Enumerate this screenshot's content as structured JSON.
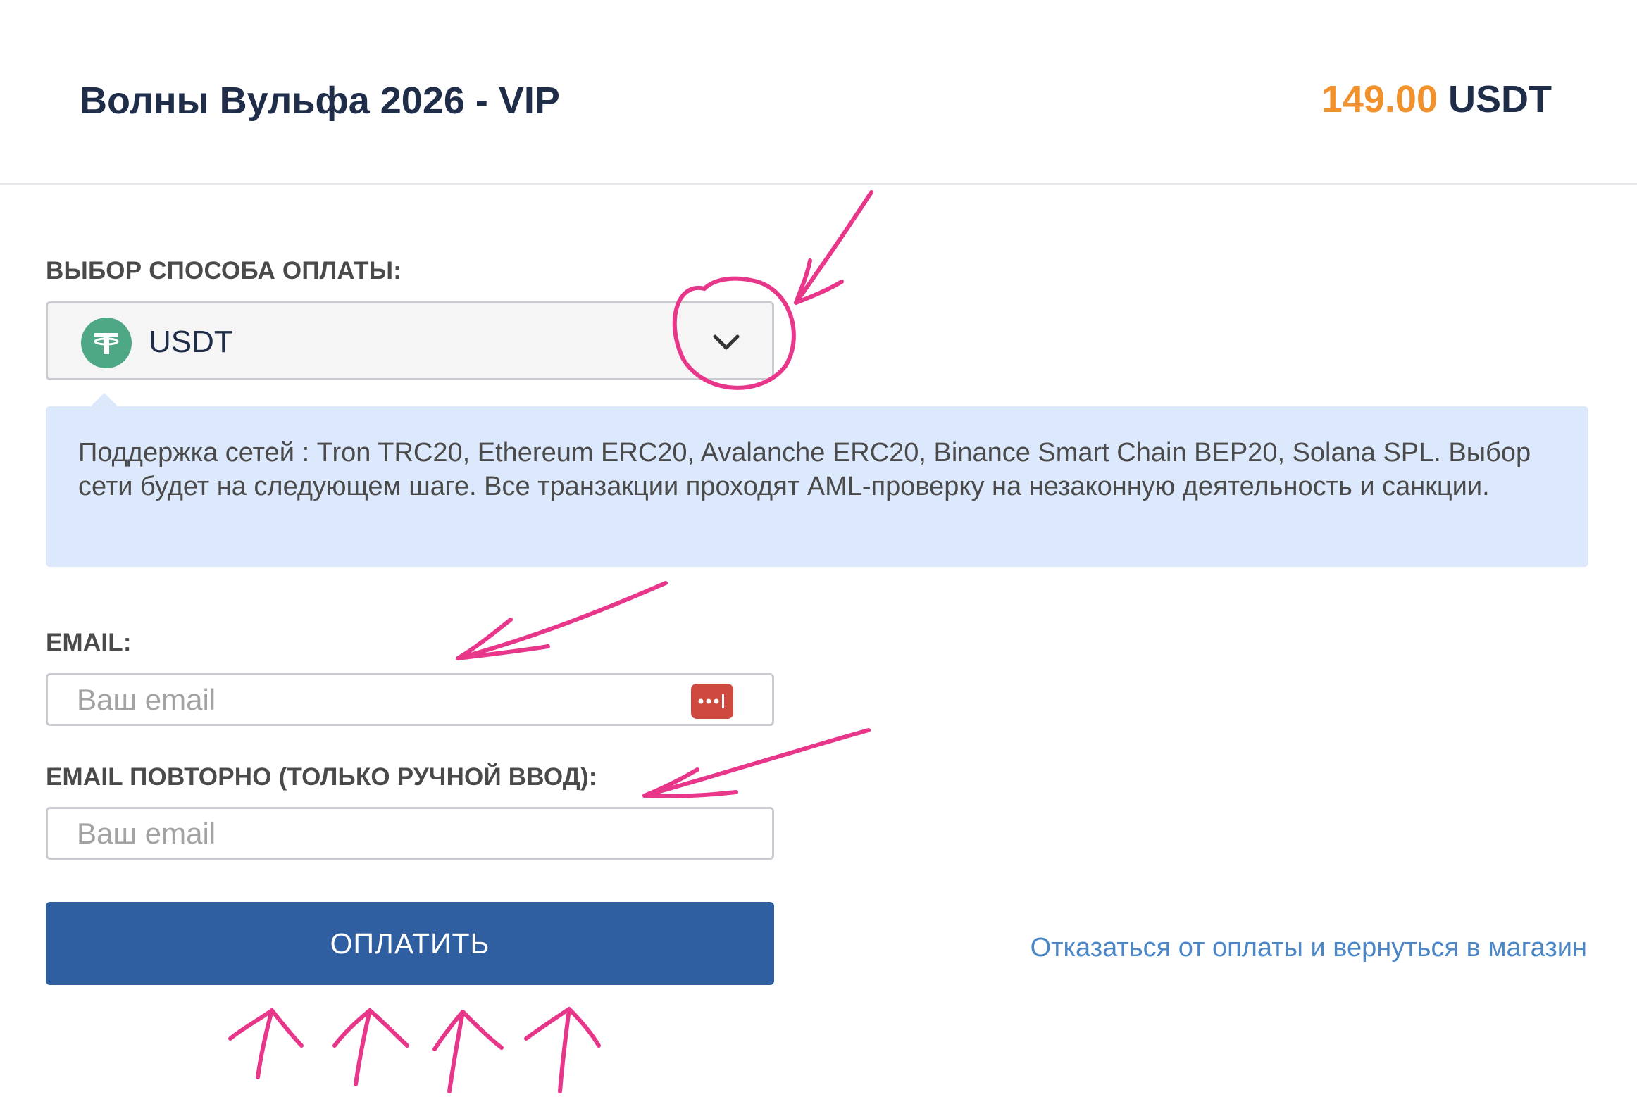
{
  "header": {
    "product_title": "Волны Вульфа 2026 - VIP",
    "price_amount": "149.00",
    "price_currency": "USDT"
  },
  "payment": {
    "label": "ВЫБОР СПОСОБА ОПЛАТЫ:",
    "selected_method": "USDT",
    "method_icon": "tether-icon",
    "info_text": "Поддержка сетей : Tron TRC20, Ethereum ERC20, Avalanche ERC20, Binance Smart Chain BEP20, Solana SPL. Выбор сети будет на следующем шаге. Все транзакции проходят AML-проверку на незаконную деятельность и санкции."
  },
  "email": {
    "label": "EMAIL:",
    "placeholder": "Ваш email",
    "value": ""
  },
  "email_repeat": {
    "label": "EMAIL ПОВТОРНО (ТОЛЬКО РУЧНОЙ ВВОД):",
    "placeholder": "Ваш email",
    "value": ""
  },
  "actions": {
    "pay_label": "ОПЛАТИТЬ",
    "cancel_label": "Отказаться от оплаты и вернуться в магазин"
  },
  "colors": {
    "title": "#1f2d49",
    "price_accent": "#f0912c",
    "pay_button": "#2f5ea1",
    "link": "#4b86c6",
    "info_bg": "#dce8fb",
    "tether": "#4ea886",
    "annotation": "#e8378a"
  }
}
